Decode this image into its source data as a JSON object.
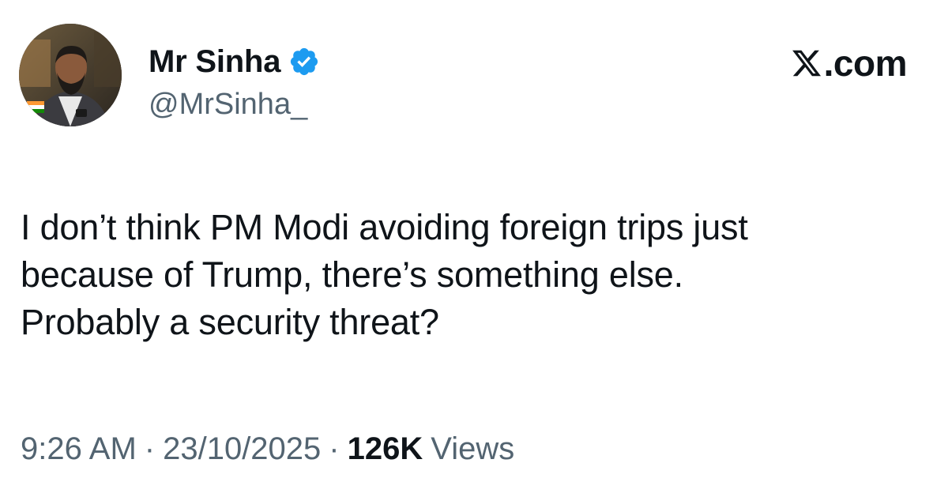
{
  "author": {
    "display_name": "Mr Sinha",
    "handle": "@MrSinha_",
    "verified": true,
    "verified_color": "#1d9bf0",
    "avatar_icon": "profile-photo"
  },
  "brand": {
    "label": ".com",
    "icon": "x-logo-icon"
  },
  "tweet": {
    "text": "I don’t think PM Modi avoiding foreign trips just\nbecause of Trump, there’s something else.\nProbably a security threat?"
  },
  "meta": {
    "time": "9:26 AM",
    "separator": "·",
    "date": "23/10/2025",
    "views_count": "126K",
    "views_label": "Views"
  },
  "colors": {
    "primary_text": "#0f1419",
    "secondary_text": "#536471",
    "background": "#ffffff"
  }
}
